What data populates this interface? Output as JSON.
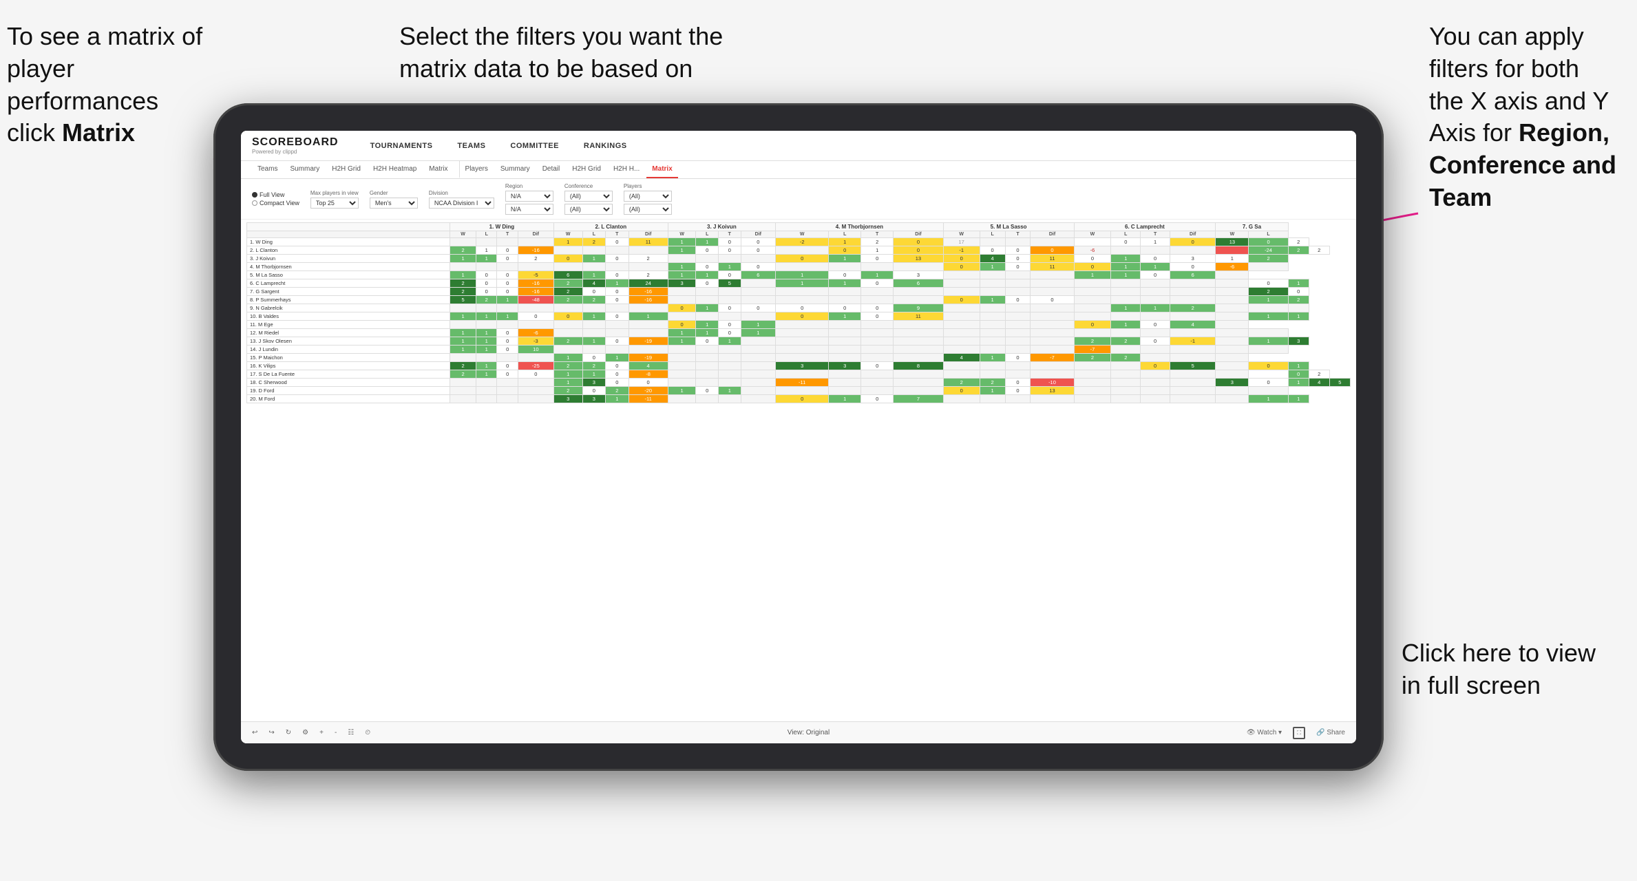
{
  "annotations": {
    "top_left": {
      "line1": "To see a matrix of",
      "line2": "player performances",
      "line3_normal": "click ",
      "line3_bold": "Matrix"
    },
    "top_center": {
      "line1": "Select the filters you want the",
      "line2": "matrix data to be based on"
    },
    "top_right": {
      "line1": "You  can apply",
      "line2": "filters for both",
      "line3": "the X axis and Y",
      "line4_normal": "Axis for ",
      "line4_bold": "Region,",
      "line5_bold": "Conference and",
      "line6_bold": "Team"
    },
    "bottom_right": {
      "line1": "Click here to view",
      "line2": "in full screen"
    }
  },
  "nav": {
    "logo_main": "SCOREBOARD",
    "logo_sub": "Powered by clippd",
    "items": [
      "TOURNAMENTS",
      "TEAMS",
      "COMMITTEE",
      "RANKINGS"
    ]
  },
  "sub_nav": {
    "items": [
      "Teams",
      "Summary",
      "H2H Grid",
      "H2H Heatmap",
      "Matrix",
      "Players",
      "Summary",
      "Detail",
      "H2H Grid",
      "H2H H...",
      "Matrix"
    ],
    "active_index": 10
  },
  "filters": {
    "view_options": [
      "Full View",
      "Compact View"
    ],
    "selected_view": "Full View",
    "max_players_label": "Max players in view",
    "max_players_value": "Top 25",
    "gender_label": "Gender",
    "gender_value": "Men's",
    "division_label": "Division",
    "division_value": "NCAA Division I",
    "region_label": "Region",
    "region_value1": "N/A",
    "region_value2": "N/A",
    "conference_label": "Conference",
    "conference_value1": "(All)",
    "conference_value2": "(All)",
    "players_label": "Players",
    "players_value1": "(All)",
    "players_value2": "(All)"
  },
  "matrix": {
    "column_headers": [
      "1. W Ding",
      "2. L Clanton",
      "3. J Koivun",
      "4. M Thorbjornsen",
      "5. M La Sasso",
      "6. C Lamprecht",
      "7. G Sa"
    ],
    "sub_headers": [
      "W",
      "L",
      "T",
      "Dif",
      "W",
      "L",
      "T",
      "Dif",
      "W",
      "L",
      "T",
      "Dif",
      "W",
      "L",
      "T",
      "Dif",
      "W",
      "L",
      "T",
      "Dif",
      "W",
      "L",
      "T",
      "Dif",
      "W",
      "L"
    ],
    "rows": [
      {
        "name": "1. W Ding",
        "cells": [
          "",
          "",
          "",
          "",
          "1",
          "2",
          "0",
          "11",
          "1",
          "1",
          "0",
          "0",
          "-2",
          "1",
          "2",
          "0",
          "17",
          "",
          "",
          "",
          "",
          "0",
          "1",
          "0",
          "13",
          "0",
          "2"
        ]
      },
      {
        "name": "2. L Clanton",
        "cells": [
          "2",
          "1",
          "0",
          "-16",
          "",
          "",
          "",
          "",
          "1",
          "0",
          "0",
          "0",
          "",
          "0",
          "1",
          "0",
          "-1",
          "0",
          "0",
          "0",
          "-6",
          "",
          "",
          "",
          "",
          "-24",
          "2",
          "2"
        ]
      },
      {
        "name": "3. J Koivun",
        "cells": [
          "1",
          "1",
          "0",
          "2",
          "0",
          "1",
          "0",
          "2",
          "",
          "",
          "",
          "",
          "0",
          "1",
          "0",
          "13",
          "0",
          "4",
          "0",
          "11",
          "0",
          "1",
          "0",
          "3",
          "1",
          "2"
        ]
      },
      {
        "name": "4. M Thorbjornsen",
        "cells": [
          "",
          "",
          "",
          "",
          "",
          "",
          "",
          "",
          "1",
          "0",
          "1",
          "0",
          "",
          "",
          "",
          "",
          "0",
          "1",
          "0",
          "11",
          "0",
          "1",
          "1",
          "0",
          "-6",
          ""
        ]
      },
      {
        "name": "5. M La Sasso",
        "cells": [
          "1",
          "0",
          "0",
          "-5",
          "6",
          "1",
          "0",
          "2",
          "1",
          "1",
          "0",
          "6",
          "1",
          "0",
          "1",
          "3",
          "",
          "",
          "",
          "",
          "1",
          "1",
          "0",
          "6",
          ""
        ]
      },
      {
        "name": "6. C Lamprecht",
        "cells": [
          "2",
          "0",
          "0",
          "-16",
          "2",
          "4",
          "1",
          "24",
          "3",
          "0",
          "5",
          "",
          "1",
          "1",
          "0",
          "6",
          "",
          "",
          "",
          "",
          "",
          "",
          "",
          "",
          "",
          "0",
          "1"
        ]
      },
      {
        "name": "7. G Sargent",
        "cells": [
          "2",
          "0",
          "0",
          "-16",
          "2",
          "0",
          "0",
          "-16",
          "",
          "",
          "",
          "",
          "",
          "",
          "",
          "",
          "",
          "",
          "",
          "",
          "",
          "",
          "",
          "",
          "",
          "2",
          "0"
        ]
      },
      {
        "name": "8. P Summerhays",
        "cells": [
          "5",
          "2",
          "1",
          "-48",
          "2",
          "2",
          "0",
          "-16",
          "",
          "",
          "",
          "",
          "",
          "",
          "",
          "",
          "0",
          "1",
          "0",
          "0",
          "",
          "",
          "",
          "",
          "",
          "1",
          "2"
        ]
      },
      {
        "name": "9. N Gabrelcik",
        "cells": [
          "",
          "",
          "",
          "",
          "",
          "",
          "",
          "",
          "0",
          "1",
          "0",
          "0",
          "0",
          "0",
          "0",
          "9",
          "",
          "",
          "",
          "",
          "",
          "1",
          "1",
          "2",
          "",
          "",
          ""
        ]
      },
      {
        "name": "10. B Valdes",
        "cells": [
          "1",
          "1",
          "1",
          "0",
          "0",
          "1",
          "0",
          "1",
          "",
          "",
          "",
          "",
          "0",
          "1",
          "0",
          "11",
          "",
          "",
          "",
          "",
          "",
          "",
          "",
          "",
          "",
          "1",
          "1"
        ]
      },
      {
        "name": "11. M Ege",
        "cells": [
          "",
          "",
          "",
          "",
          "",
          "",
          "",
          "",
          "0",
          "1",
          "0",
          "1",
          "",
          "",
          "",
          "",
          "",
          "",
          "",
          "",
          "0",
          "1",
          "0",
          "4",
          ""
        ]
      },
      {
        "name": "12. M Riedel",
        "cells": [
          "1",
          "1",
          "0",
          "-6",
          "",
          "",
          "",
          "",
          "1",
          "1",
          "0",
          "1",
          "",
          "",
          "",
          "",
          "",
          "",
          "",
          "",
          "",
          "",
          "",
          "",
          "",
          ""
        ]
      },
      {
        "name": "13. J Skov Olesen",
        "cells": [
          "1",
          "1",
          "0",
          "-3",
          "2",
          "1",
          "0",
          "-19",
          "1",
          "0",
          "1",
          "",
          "",
          "",
          "",
          "",
          "",
          "",
          "",
          "",
          "2",
          "2",
          "0",
          "-1",
          "",
          "1",
          "3"
        ]
      },
      {
        "name": "14. J Lundin",
        "cells": [
          "1",
          "1",
          "0",
          "10",
          "",
          "",
          "",
          "",
          "",
          "",
          "",
          "",
          "",
          "",
          "",
          "",
          "",
          "",
          "",
          "",
          "-7",
          "",
          "",
          "",
          "",
          ""
        ]
      },
      {
        "name": "15. P Maichon",
        "cells": [
          "",
          "",
          "",
          "",
          "1",
          "0",
          "1",
          "-19",
          "",
          "",
          "",
          "",
          "",
          "",
          "",
          "",
          "4",
          "1",
          "0",
          "-7",
          "2",
          "2",
          "",
          "",
          ""
        ]
      },
      {
        "name": "16. K Vilips",
        "cells": [
          "2",
          "1",
          "0",
          "-25",
          "2",
          "2",
          "0",
          "4",
          "",
          "",
          "",
          "",
          "3",
          "3",
          "0",
          "8",
          "",
          "",
          "",
          "",
          "",
          "",
          "0",
          "5",
          "",
          "0",
          "1"
        ]
      },
      {
        "name": "17. S De La Fuente",
        "cells": [
          "2",
          "1",
          "0",
          "0",
          "1",
          "1",
          "0",
          "-8",
          "",
          "",
          "",
          "",
          "",
          "",
          "",
          "",
          "",
          "",
          "",
          "",
          "",
          "",
          "",
          "",
          "",
          "",
          "0",
          "2"
        ]
      },
      {
        "name": "18. C Sherwood",
        "cells": [
          "",
          "",
          "",
          "",
          "1",
          "3",
          "0",
          "0",
          "",
          "",
          "",
          "",
          "-11",
          "",
          "",
          "",
          "2",
          "2",
          "0",
          "-10",
          "",
          "",
          "",
          "",
          "3",
          "0",
          "1",
          "4",
          "5"
        ]
      },
      {
        "name": "19. D Ford",
        "cells": [
          "",
          "",
          "",
          "",
          "2",
          "0",
          "2",
          "-20",
          "1",
          "0",
          "1",
          "",
          "",
          "",
          "",
          "",
          "0",
          "1",
          "0",
          "13",
          "",
          "",
          "",
          "",
          "",
          ""
        ]
      },
      {
        "name": "20. M Ford",
        "cells": [
          "",
          "",
          "",
          "",
          "3",
          "3",
          "1",
          "-11",
          "",
          "",
          "",
          "",
          "0",
          "1",
          "0",
          "7",
          "",
          "",
          "",
          "",
          "",
          "",
          "",
          "",
          "",
          "1",
          "1"
        ]
      }
    ]
  },
  "toolbar": {
    "view_label": "View: Original",
    "watch_label": "Watch",
    "share_label": "Share"
  }
}
